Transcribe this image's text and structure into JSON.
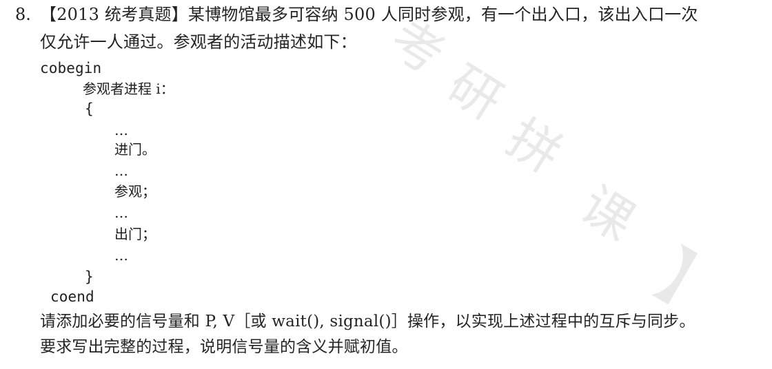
{
  "question": {
    "number": "8.",
    "title_line": "【2013 统考真题】某博物馆最多可容纳 500 人同时参观，有一个出入口，该出入口一次",
    "description_line_2": "仅允许一人通过。参观者的活动描述如下："
  },
  "code": {
    "cobegin": "cobegin",
    "process": "参观者进程 i：",
    "brace_open": "{",
    "dots_1": "…",
    "enter": "进门。",
    "dots_2": "…",
    "visit": "参观；",
    "dots_3": "…",
    "exit": "出门；",
    "dots_4": "…",
    "brace_close": "}",
    "coend": "coend"
  },
  "requirements": {
    "line_1": "请添加必要的信号量和 P, V［或 wait(), signal()］操作，以实现上述过程中的互斥与同步。",
    "line_2": "要求写出完整的过程，说明信号量的含义并赋初值。"
  },
  "watermark": {
    "text": "考研拼课】",
    "color": "#000000"
  }
}
